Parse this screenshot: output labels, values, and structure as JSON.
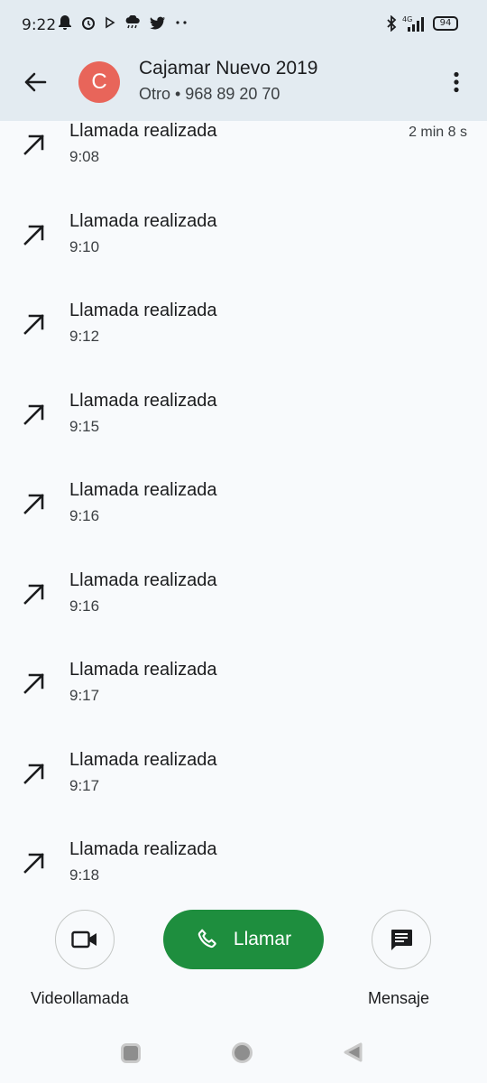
{
  "status_bar": {
    "time": "9:22",
    "network": "4G",
    "battery": "94",
    "icons": [
      "notification-bell-icon",
      "alarm-icon",
      "play-icon",
      "weather-icon",
      "twitter-icon",
      "more-dots-icon",
      "bluetooth-icon",
      "signal-icon",
      "battery-icon"
    ]
  },
  "header": {
    "avatar_letter": "C",
    "avatar_color": "#e8655a",
    "contact_name": "Cajamar Nuevo 2019",
    "contact_subtitle": "Otro • 968 89 20 70"
  },
  "calls": [
    {
      "type": "Llamada realizada",
      "time": "9:08",
      "duration": "2 min 8 s"
    },
    {
      "type": "Llamada realizada",
      "time": "9:10",
      "duration": ""
    },
    {
      "type": "Llamada realizada",
      "time": "9:12",
      "duration": ""
    },
    {
      "type": "Llamada realizada",
      "time": "9:15",
      "duration": ""
    },
    {
      "type": "Llamada realizada",
      "time": "9:16",
      "duration": ""
    },
    {
      "type": "Llamada realizada",
      "time": "9:16",
      "duration": ""
    },
    {
      "type": "Llamada realizada",
      "time": "9:17",
      "duration": ""
    },
    {
      "type": "Llamada realizada",
      "time": "9:17",
      "duration": ""
    },
    {
      "type": "Llamada realizada",
      "time": "9:18",
      "duration": ""
    }
  ],
  "actions": {
    "video_label": "Videollamada",
    "call_label": "Llamar",
    "message_label": "Mensaje",
    "call_color": "#1e8e3e"
  }
}
